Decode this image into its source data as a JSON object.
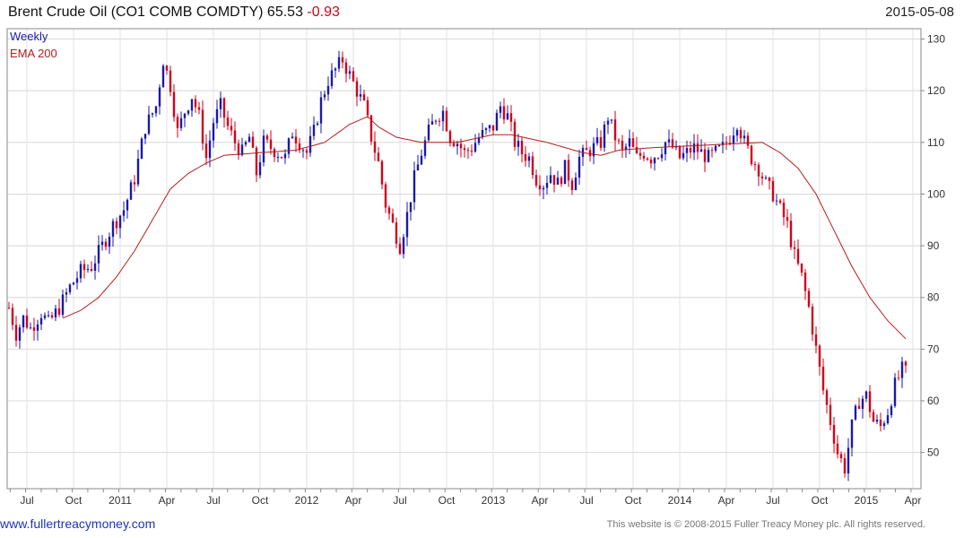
{
  "header": {
    "title": "Brent Crude Oil  (CO1 COMB COMDTY) 65.53",
    "change": "-0.93",
    "date": "2015-05-08"
  },
  "footer": {
    "website": "www.fullertreacymoney.com",
    "copyright": "This website is © 2008-2015 Fuller Treacy Money plc. All rights reserved."
  },
  "chart_data": {
    "type": "line",
    "legend": [
      {
        "label": "Weekly",
        "color": "#1a1aa8"
      },
      {
        "label": "EMA 200",
        "color": "#b31d1d"
      }
    ],
    "legend_placement": "top-left",
    "ylim": [
      43,
      132
    ],
    "y_ticks": [
      50,
      60,
      70,
      80,
      90,
      100,
      110,
      120,
      130
    ],
    "y_axis_side": "right",
    "grid": true,
    "x_range_weeks": [
      0,
      232
    ],
    "x_ticks": [
      {
        "label": "Jul",
        "week": 5
      },
      {
        "label": "Oct",
        "week": 18
      },
      {
        "label": "2011",
        "week": 31
      },
      {
        "label": "Apr",
        "week": 44
      },
      {
        "label": "Jul",
        "week": 57
      },
      {
        "label": "Oct",
        "week": 70
      },
      {
        "label": "2012",
        "week": 83
      },
      {
        "label": "Apr",
        "week": 96
      },
      {
        "label": "Jul",
        "week": 109
      },
      {
        "label": "Oct",
        "week": 122
      },
      {
        "label": "2013",
        "week": 135
      },
      {
        "label": "Apr",
        "week": 148
      },
      {
        "label": "Jul",
        "week": 161
      },
      {
        "label": "Oct",
        "week": 174
      },
      {
        "label": "2014",
        "week": 187
      },
      {
        "label": "Apr",
        "week": 200
      },
      {
        "label": "Jul",
        "week": 213
      },
      {
        "label": "Oct",
        "week": 226
      },
      {
        "label": "2015",
        "week": 239
      },
      {
        "label": "Apr",
        "week": 252
      }
    ],
    "weekly_close_anchors": [
      [
        0,
        78
      ],
      [
        2,
        73
      ],
      [
        4,
        76
      ],
      [
        6,
        74
      ],
      [
        9,
        77
      ],
      [
        11,
        75
      ],
      [
        14,
        78
      ],
      [
        17,
        82
      ],
      [
        20,
        85
      ],
      [
        23,
        86
      ],
      [
        26,
        90
      ],
      [
        29,
        94
      ],
      [
        32,
        97
      ],
      [
        35,
        103
      ],
      [
        38,
        113
      ],
      [
        41,
        117
      ],
      [
        43,
        126
      ],
      [
        45,
        121
      ],
      [
        47,
        112
      ],
      [
        49,
        116
      ],
      [
        51,
        119
      ],
      [
        53,
        115
      ],
      [
        55,
        107
      ],
      [
        57,
        114
      ],
      [
        59,
        117
      ],
      [
        61,
        113
      ],
      [
        63,
        110
      ],
      [
        65,
        108
      ],
      [
        67,
        111
      ],
      [
        69,
        104
      ],
      [
        71,
        110
      ],
      [
        73,
        109
      ],
      [
        75,
        108
      ],
      [
        77,
        107
      ],
      [
        79,
        112
      ],
      [
        81,
        110
      ],
      [
        83,
        108
      ],
      [
        85,
        112
      ],
      [
        87,
        118
      ],
      [
        89,
        122
      ],
      [
        91,
        124
      ],
      [
        93,
        126
      ],
      [
        95,
        123
      ],
      [
        97,
        120
      ],
      [
        99,
        117
      ],
      [
        101,
        111
      ],
      [
        103,
        106
      ],
      [
        105,
        98
      ],
      [
        107,
        94
      ],
      [
        109,
        90
      ],
      [
        111,
        96
      ],
      [
        113,
        103
      ],
      [
        115,
        108
      ],
      [
        117,
        112
      ],
      [
        119,
        115
      ],
      [
        121,
        116
      ],
      [
        123,
        111
      ],
      [
        125,
        110
      ],
      [
        127,
        108
      ],
      [
        129,
        109
      ],
      [
        131,
        111
      ],
      [
        133,
        112
      ],
      [
        135,
        113
      ],
      [
        137,
        117
      ],
      [
        139,
        115
      ],
      [
        141,
        110
      ],
      [
        143,
        108
      ],
      [
        145,
        107
      ],
      [
        147,
        103
      ],
      [
        149,
        102
      ],
      [
        151,
        104
      ],
      [
        153,
        102
      ],
      [
        155,
        105
      ],
      [
        157,
        102
      ],
      [
        159,
        107
      ],
      [
        161,
        108
      ],
      [
        163,
        109
      ],
      [
        165,
        110
      ],
      [
        167,
        115
      ],
      [
        169,
        111
      ],
      [
        171,
        108
      ],
      [
        173,
        110
      ],
      [
        175,
        107
      ],
      [
        177,
        108
      ],
      [
        179,
        107
      ],
      [
        181,
        108
      ],
      [
        183,
        110
      ],
      [
        185,
        109
      ],
      [
        187,
        107
      ],
      [
        189,
        108
      ],
      [
        191,
        109
      ],
      [
        193,
        108
      ],
      [
        195,
        107
      ],
      [
        197,
        108
      ],
      [
        199,
        109
      ],
      [
        201,
        111
      ],
      [
        203,
        114
      ],
      [
        205,
        110
      ],
      [
        207,
        107
      ],
      [
        209,
        105
      ],
      [
        211,
        102
      ],
      [
        213,
        100
      ],
      [
        215,
        97
      ],
      [
        217,
        94
      ],
      [
        219,
        88
      ],
      [
        221,
        84
      ],
      [
        223,
        78
      ],
      [
        225,
        70
      ],
      [
        227,
        62
      ],
      [
        229,
        56
      ],
      [
        231,
        50
      ],
      [
        233,
        47
      ],
      [
        235,
        55
      ],
      [
        237,
        60
      ],
      [
        239,
        61
      ],
      [
        241,
        56
      ],
      [
        243,
        55
      ],
      [
        245,
        58
      ],
      [
        247,
        63
      ],
      [
        249,
        66
      ],
      [
        250,
        65.5
      ]
    ],
    "ema200_anchors": [
      [
        15,
        76
      ],
      [
        20,
        77.5
      ],
      [
        25,
        80
      ],
      [
        30,
        84
      ],
      [
        35,
        89
      ],
      [
        40,
        95
      ],
      [
        45,
        101
      ],
      [
        50,
        104
      ],
      [
        55,
        106
      ],
      [
        60,
        107.5
      ],
      [
        70,
        108
      ],
      [
        80,
        108.5
      ],
      [
        88,
        110
      ],
      [
        95,
        113.5
      ],
      [
        100,
        115
      ],
      [
        103,
        113
      ],
      [
        108,
        111
      ],
      [
        115,
        110
      ],
      [
        125,
        110
      ],
      [
        135,
        111.5
      ],
      [
        140,
        111.5
      ],
      [
        150,
        110
      ],
      [
        160,
        108
      ],
      [
        165,
        107.5
      ],
      [
        170,
        108.5
      ],
      [
        180,
        109
      ],
      [
        195,
        109.5
      ],
      [
        210,
        110
      ],
      [
        215,
        108
      ],
      [
        220,
        105
      ],
      [
        225,
        100
      ],
      [
        230,
        93
      ],
      [
        235,
        86
      ],
      [
        240,
        80
      ],
      [
        245,
        75.5
      ],
      [
        250,
        72
      ]
    ]
  }
}
